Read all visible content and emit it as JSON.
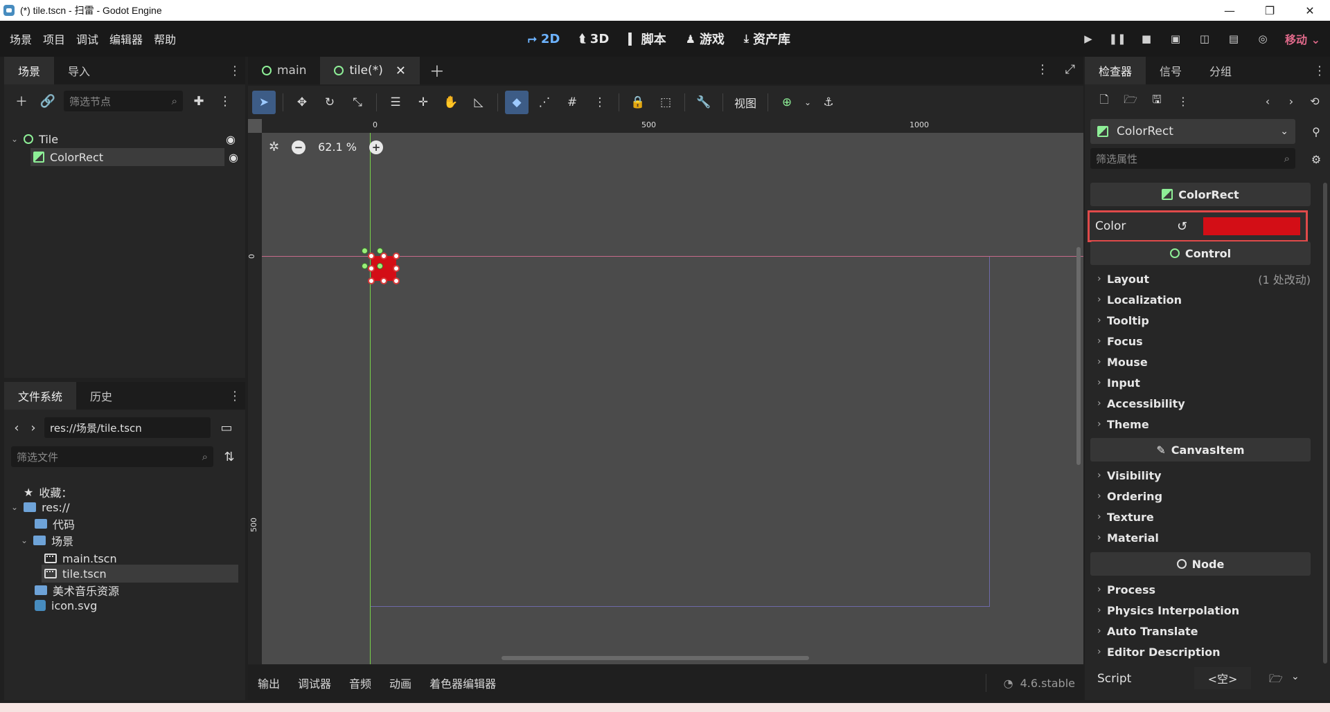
{
  "window": {
    "title": "(*) tile.tscn - 扫雷 - Godot Engine",
    "minimize": "—",
    "maximize": "❐",
    "close": "✕"
  },
  "menu": {
    "items": [
      "场景",
      "项目",
      "调试",
      "编辑器",
      "帮助"
    ]
  },
  "main_screens": [
    {
      "label": "2D",
      "icon": "⮣"
    },
    {
      "label": "3D",
      "icon": "⮬"
    },
    {
      "label": "脚本",
      "icon": "▍"
    },
    {
      "label": "游戏",
      "icon": "♟"
    },
    {
      "label": "资产库",
      "icon": "⤓"
    }
  ],
  "run_bar": {
    "renderer": "移动 ⌄"
  },
  "scene_dock": {
    "tabs": [
      "场景",
      "导入"
    ],
    "filter_placeholder": "筛选节点",
    "nodes": [
      {
        "name": "Tile",
        "type": "Node2D"
      },
      {
        "name": "ColorRect",
        "type": "ColorRect"
      }
    ]
  },
  "filesystem_dock": {
    "tabs": [
      "文件系统",
      "历史"
    ],
    "path": "res://场景/tile.tscn",
    "filter_placeholder": "筛选文件",
    "favorites": "收藏：",
    "tree": [
      {
        "name": "res://",
        "kind": "folder"
      },
      {
        "name": "代码",
        "kind": "folder"
      },
      {
        "name": "场景",
        "kind": "folder"
      },
      {
        "name": "main.tscn",
        "kind": "scene"
      },
      {
        "name": "tile.tscn",
        "kind": "scene"
      },
      {
        "name": "美术音乐资源",
        "kind": "folder"
      },
      {
        "name": "icon.svg",
        "kind": "svg"
      }
    ]
  },
  "editor_tabs": [
    {
      "label": "main"
    },
    {
      "label": "tile(*)"
    }
  ],
  "viewport_toolbar": {
    "view_label": "视图"
  },
  "canvas": {
    "zoom": "62.1 %",
    "ruler_top": [
      "0",
      "500",
      "1000"
    ],
    "ruler_left": [
      "0",
      "500"
    ],
    "rect_color": "#d30e16"
  },
  "bottom_dock": {
    "tabs": [
      "输出",
      "调试器",
      "音频",
      "动画",
      "着色器编辑器"
    ],
    "version": "4.6.stable"
  },
  "inspector": {
    "tabs": [
      "检查器",
      "信号",
      "分组"
    ],
    "node_selector": "ColorRect",
    "filter_placeholder": "筛选属性",
    "sections": {
      "colorrect": "ColorRect",
      "control": "Control",
      "canvasitem": "CanvasItem",
      "node": "Node"
    },
    "color_label": "Color",
    "color_value": "#d30e16",
    "control_props": [
      "Layout",
      "Localization",
      "Tooltip",
      "Focus",
      "Mouse",
      "Input",
      "Accessibility",
      "Theme"
    ],
    "layout_note": "(1 处改动)",
    "canvasitem_props": [
      "Visibility",
      "Ordering",
      "Texture",
      "Material"
    ],
    "node_props": [
      "Process",
      "Physics Interpolation",
      "Auto Translate",
      "Editor Description"
    ],
    "script_label": "Script",
    "script_value": "<空>"
  }
}
